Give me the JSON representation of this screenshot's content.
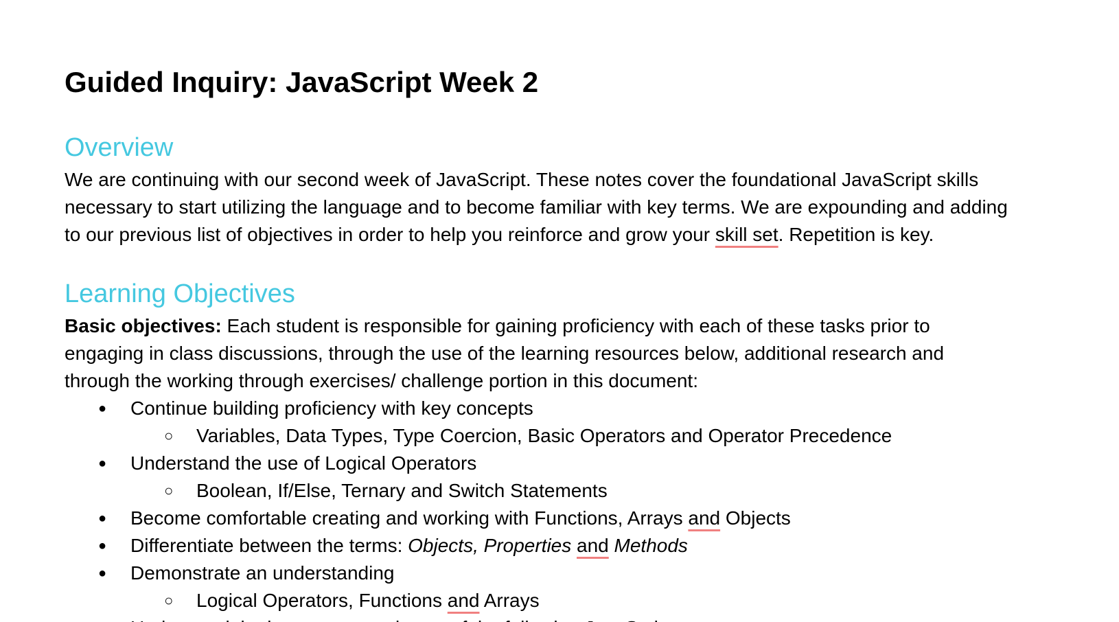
{
  "document": {
    "title": "Guided Inquiry: JavaScript Week 2",
    "accent_color": "#45c8e0",
    "spellcheck_color": "#f08080"
  },
  "overview": {
    "heading": "Overview",
    "lines": {
      "l1": "We are continuing with our second week of JavaScript. These notes cover the foundational JavaScript skills",
      "l2": "necessary to start utilizing the language and to become familiar with key terms. We are expounding and adding",
      "l3_a": "to our previous list of objectives in order to help you reinforce and grow your ",
      "l3_flagged": "skill set",
      "l3_b": ".  Repetition is key."
    }
  },
  "learning_objectives": {
    "heading": "Learning Objectives",
    "intro": {
      "label": "Basic objectives:",
      "l1": " Each student is responsible for gaining proficiency with each of these tasks prior to",
      "l2": "engaging in class discussions, through the use of the learning resources below, additional research and",
      "l3": "through the working through exercises/ challenge portion in this document:"
    },
    "bullet_glyph": "●",
    "sub_bullet_glyph": "○",
    "items": [
      {
        "text": "Continue building proficiency with key concepts"
      },
      {
        "text": "Variables, Data Types, Type Coercion, Basic Operators and Operator Precedence"
      },
      {
        "text": "Understand the use of Logical Operators"
      },
      {
        "text": "Boolean, If/Else, Ternary and Switch Statements"
      },
      {
        "a": "Become comfortable creating and working with Functions, Arrays ",
        "flagged": "and",
        "b": " Objects"
      },
      {
        "a": "Differentiate between the terms: ",
        "i1": "Objects, Properties",
        "sp": " ",
        "flagged": "and",
        "sp2": " ",
        "i2": "Methods"
      },
      {
        "text": "Demonstrate an understanding"
      },
      {
        "a": "Logical Operators, Functions ",
        "flagged": "and",
        "b": " Arrays"
      },
      {
        "text": "Understand the importance and uses of the following JavaScript..."
      }
    ]
  }
}
